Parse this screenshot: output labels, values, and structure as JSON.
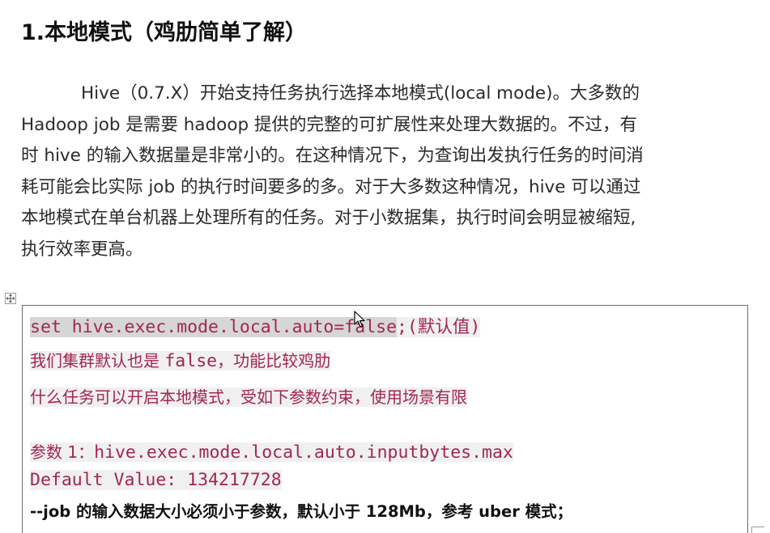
{
  "document": {
    "heading": "1.本地模式（鸡肋简单了解）",
    "paragraph_lines": [
      "Hive（0.7.X）开始支持任务执行选择本地模式(local mode)。大多数的",
      "Hadoop job 是需要 hadoop 提供的完整的可扩展性来处理大数据的。不过，有",
      "时 hive 的输入数据量是非常小的。在这种情况下，为查询出发执行任务的时间消",
      "耗可能会比实际 job 的执行时间要多的多。对于大多数这种情况，hive 可以通过",
      "本地模式在单台机器上处理所有的任务。对于小数据集，执行时间会明显被缩短,",
      "执行效率更高。"
    ]
  },
  "code_block": {
    "line1_selected": "set hive.exec.mode.local.auto=false",
    "line1_rest": ";(默认值)",
    "line2_cn_a": "我们集群默认也是 ",
    "line2_mono": "false",
    "line2_cn_b": "，功能比较鸡肋",
    "line3": "什么任务可以开启本地模式，受如下参数约束，使用场景有限",
    "line4_cn": "参数 1：",
    "line4_mono": "hive.exec.mode.local.auto.inputbytes.max",
    "line5": "Default Value: 134217728",
    "line6": "--job 的输入数据大小必须小于参数，默认小于 128Mb，参考 uber 模式；"
  },
  "icons": {
    "table_anchor": "move-anchor-icon",
    "cursor": "mouse-pointer-icon"
  },
  "colors": {
    "code_text": "#a3264f",
    "selection": "#d6d6d6",
    "code_highlight": "#f0f0f0"
  }
}
